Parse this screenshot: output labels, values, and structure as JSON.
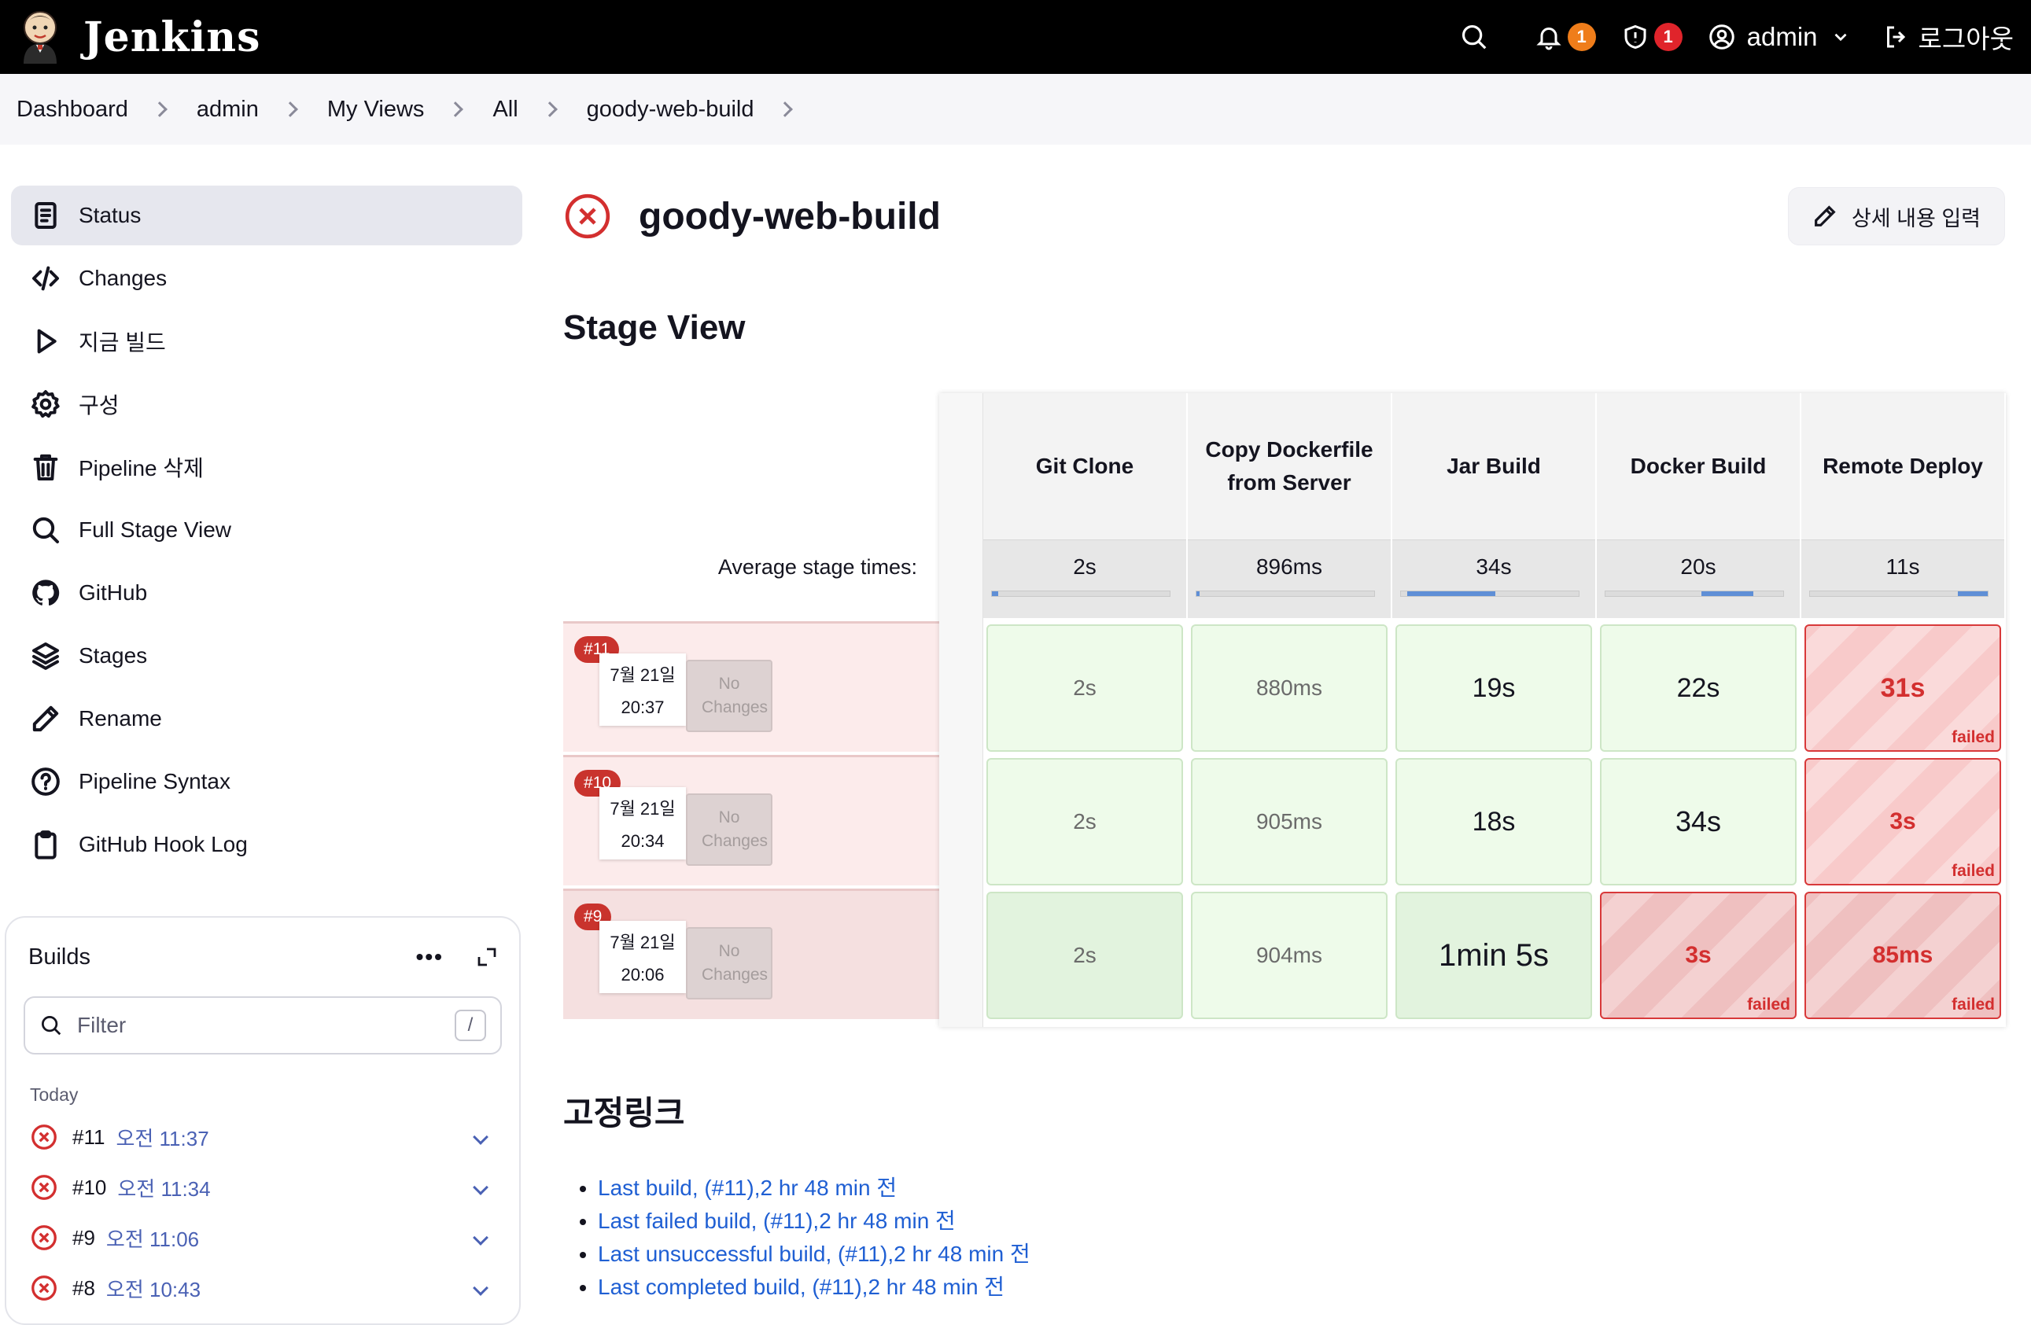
{
  "header": {
    "app_name": "Jenkins",
    "notifications_count": "1",
    "security_count": "1",
    "user": "admin",
    "logout_label": "로그아웃"
  },
  "breadcrumb": [
    "Dashboard",
    "admin",
    "My Views",
    "All",
    "goody-web-build"
  ],
  "sidebar": {
    "items": [
      {
        "label": "Status",
        "icon": "document-icon"
      },
      {
        "label": "Changes",
        "icon": "code-icon"
      },
      {
        "label": "지금 빌드",
        "icon": "play-icon"
      },
      {
        "label": "구성",
        "icon": "gear-icon"
      },
      {
        "label": "Pipeline 삭제",
        "icon": "trash-icon"
      },
      {
        "label": "Full Stage View",
        "icon": "search-icon"
      },
      {
        "label": "GitHub",
        "icon": "github-icon"
      },
      {
        "label": "Stages",
        "icon": "layers-icon"
      },
      {
        "label": "Rename",
        "icon": "pencil-icon"
      },
      {
        "label": "Pipeline Syntax",
        "icon": "help-icon"
      },
      {
        "label": "GitHub Hook Log",
        "icon": "clipboard-icon"
      }
    ]
  },
  "builds": {
    "title": "Builds",
    "filter_placeholder": "Filter",
    "filter_shortcut": "/",
    "group": "Today",
    "rows": [
      {
        "num": "#11",
        "time": "오전 11:37"
      },
      {
        "num": "#10",
        "time": "오전 11:34"
      },
      {
        "num": "#9",
        "time": "오전 11:06"
      },
      {
        "num": "#8",
        "time": "오전 10:43"
      }
    ]
  },
  "job": {
    "title": "goody-web-build",
    "status_color": "#d32f2f",
    "edit_label": "상세 내용 입력"
  },
  "stage_view": {
    "title": "Stage View",
    "avg_label": "Average stage times:",
    "stages": [
      {
        "name": "Git Clone",
        "avg": "2s"
      },
      {
        "name": "Copy Dockerfile from Server",
        "avg": "896ms"
      },
      {
        "name": "Jar Build",
        "avg": "34s"
      },
      {
        "name": "Docker Build",
        "avg": "20s"
      },
      {
        "name": "Remote Deploy",
        "avg": "11s"
      }
    ],
    "runs": [
      {
        "badge": "#11",
        "date": "7월 21일",
        "time": "20:37",
        "changes": "No Changes",
        "cells": [
          "2s",
          "880ms",
          "19s",
          "22s",
          "31s"
        ],
        "failed_label": "failed"
      },
      {
        "badge": "#10",
        "date": "7월 21일",
        "time": "20:34",
        "changes": "No Changes",
        "cells": [
          "2s",
          "905ms",
          "18s",
          "34s",
          "3s"
        ],
        "failed_label": "failed"
      },
      {
        "badge": "#9",
        "date": "7월 21일",
        "time": "20:06",
        "changes": "No Changes",
        "cells": [
          "2s",
          "904ms",
          "1min 5s",
          "3s",
          "85ms"
        ],
        "failed_label": "failed"
      }
    ]
  },
  "permalinks": {
    "title": "고정링크",
    "items": [
      "Last build, (#11),2 hr 48 min 전",
      "Last failed build, (#11),2 hr 48 min 전",
      "Last unsuccessful build, (#11),2 hr 48 min 전",
      "Last completed build, (#11),2 hr 48 min 전"
    ]
  }
}
